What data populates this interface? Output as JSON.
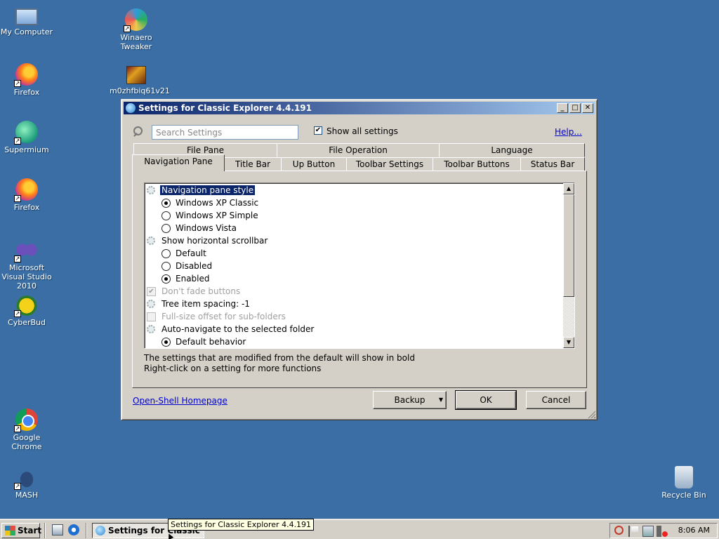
{
  "desktop": {
    "icons": [
      {
        "label": "My Computer",
        "icon": "computer-icon"
      },
      {
        "label": "Winaero Tweaker",
        "icon": "winaero-icon"
      },
      {
        "label": "Firefox",
        "icon": "firefox-icon"
      },
      {
        "label": "m0zhfbiq61v21",
        "icon": "image-file-icon"
      },
      {
        "label": "Supermium",
        "icon": "supermium-icon"
      },
      {
        "label": "Firefox",
        "icon": "firefox-icon"
      },
      {
        "label": "Microsoft Visual Studio 2010",
        "icon": "visual-studio-icon"
      },
      {
        "label": "CyberBud",
        "icon": "cyberbud-icon"
      },
      {
        "label": "Google Chrome",
        "icon": "chrome-icon"
      },
      {
        "label": "MASH",
        "icon": "mash-icon"
      },
      {
        "label": "Recycle Bin",
        "icon": "recycle-bin-icon"
      }
    ]
  },
  "window": {
    "title": "Settings for Classic Explorer 4.4.191",
    "controls": {
      "minimize": "_",
      "maximize": "□",
      "close": "✕"
    },
    "search": {
      "placeholder": "Search Settings",
      "value": ""
    },
    "show_all": {
      "label": "Show all settings",
      "checked": true
    },
    "help_label": "Help...",
    "tabs_top": [
      "File Pane",
      "File Operation",
      "Language"
    ],
    "tabs_bottom": [
      "Navigation Pane",
      "Title Bar",
      "Up Button",
      "Toolbar Settings",
      "Toolbar Buttons",
      "Status Bar"
    ],
    "active_tab": "Navigation Pane",
    "settings": [
      {
        "kind": "group",
        "label": "Navigation pane style",
        "selected": true
      },
      {
        "kind": "option",
        "label": "Windows XP Classic",
        "checked": true
      },
      {
        "kind": "option",
        "label": "Windows XP Simple",
        "checked": false
      },
      {
        "kind": "option",
        "label": "Windows Vista",
        "checked": false
      },
      {
        "kind": "group",
        "label": "Show horizontal scrollbar"
      },
      {
        "kind": "option",
        "label": "Default",
        "checked": false
      },
      {
        "kind": "option",
        "label": "Disabled",
        "checked": false
      },
      {
        "kind": "option",
        "label": "Enabled",
        "checked": true
      },
      {
        "kind": "checkbox",
        "label": "Don't fade buttons",
        "checked": true,
        "disabled": true
      },
      {
        "kind": "group",
        "label": "Tree item spacing: -1"
      },
      {
        "kind": "checkbox",
        "label": "Full-size offset for sub-folders",
        "checked": false,
        "disabled": true
      },
      {
        "kind": "group",
        "label": "Auto-navigate to the selected folder"
      },
      {
        "kind": "option",
        "label": "Default behavior",
        "checked": true
      }
    ],
    "hint_line1": "The settings that are modified from the default will show in bold",
    "hint_line2": "Right-click on a setting for more functions",
    "homepage_label": "Open-Shell Homepage",
    "backup_label": "Backup",
    "ok_label": "OK",
    "cancel_label": "Cancel"
  },
  "taskbar": {
    "start_label": "Start",
    "task_label": "Settings for Classic E...",
    "tooltip": "Settings for Classic Explorer 4.4.191",
    "clock": "8:06 AM"
  }
}
